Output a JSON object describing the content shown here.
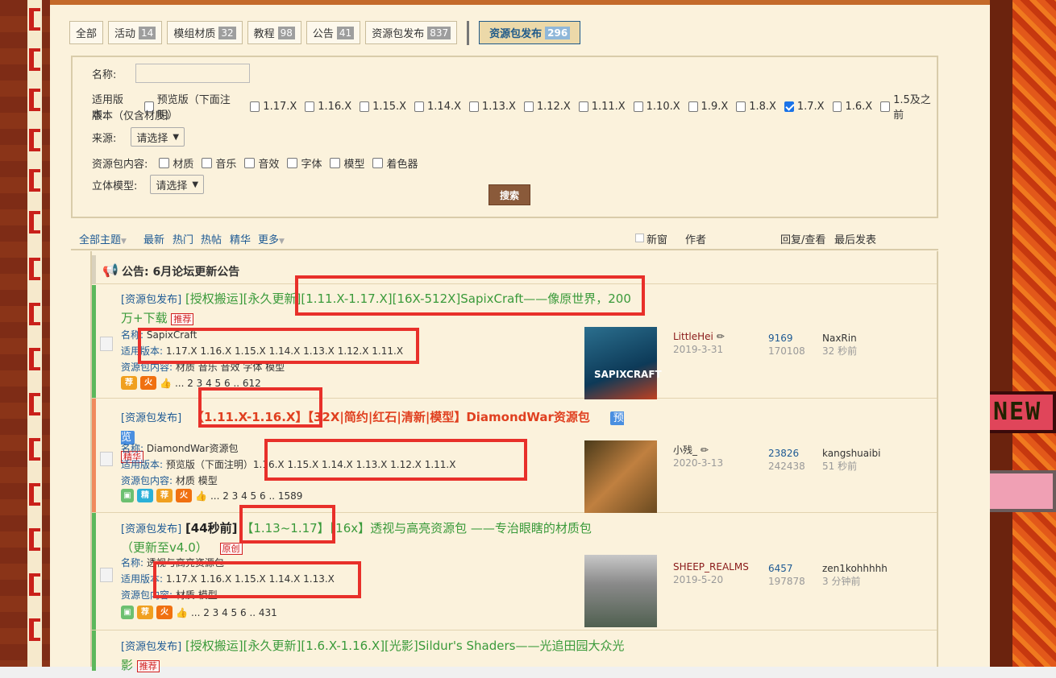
{
  "type_tabs": [
    {
      "label": "全部",
      "count": ""
    },
    {
      "label": "活动",
      "count": "14"
    },
    {
      "label": "模组材质",
      "count": "32"
    },
    {
      "label": "教程",
      "count": "98"
    },
    {
      "label": "公告",
      "count": "41"
    },
    {
      "label": "资源包发布",
      "count": "837"
    }
  ],
  "active_tab": {
    "label": "资源包发布",
    "count": "296"
  },
  "filter": {
    "name_label": "名称:",
    "version_label": "适用版本:",
    "version_label2": "版本（仅含材质）",
    "versions": [
      {
        "label": "预览版（下面注明）",
        "checked": false
      },
      {
        "label": "1.17.X",
        "checked": false
      },
      {
        "label": "1.16.X",
        "checked": false
      },
      {
        "label": "1.15.X",
        "checked": false
      },
      {
        "label": "1.14.X",
        "checked": false
      },
      {
        "label": "1.13.X",
        "checked": false
      },
      {
        "label": "1.12.X",
        "checked": false
      },
      {
        "label": "1.11.X",
        "checked": false
      },
      {
        "label": "1.10.X",
        "checked": false
      },
      {
        "label": "1.9.X",
        "checked": false
      },
      {
        "label": "1.8.X",
        "checked": false
      },
      {
        "label": "1.7.X",
        "checked": true
      },
      {
        "label": "1.6.X",
        "checked": false
      },
      {
        "label": "1.5及之前",
        "checked": false
      }
    ],
    "source_label": "来源:",
    "source_select": "请选择",
    "content_label": "资源包内容:",
    "contents": [
      "材质",
      "音乐",
      "音效",
      "字体",
      "模型",
      "着色器"
    ],
    "model_label": "立体模型:",
    "model_select": "请选择",
    "search_button": "搜索"
  },
  "sort_bar": {
    "all": "全部主题",
    "latest": "最新",
    "hot": "热门",
    "hot_post": "热帖",
    "digest": "精华",
    "more": "更多",
    "new_window": "新窗",
    "author": "作者",
    "reply_view": "回复/查看",
    "last_post": "最后发表"
  },
  "announcement": {
    "prefix": "公告:",
    "title": "6月论坛更新公告"
  },
  "threads": [
    {
      "tag": "[资源包发布]",
      "title_l1": "[授权搬运][永久更新][1.11.X-1.17.X][16X-512X]SapixCraft——像原世界，200",
      "title_l2": "万+下载",
      "badge": "推荐",
      "name_label": "名称:",
      "name": "SapixCraft",
      "ver_label": "适用版本:",
      "versions": "1.17.X 1.16.X 1.15.X 1.14.X 1.13.X 1.12.X 1.11.X",
      "content_label": "资源包内容:",
      "content": "材质 音乐 音效 字体 模型",
      "pages": "... 2  3  4  5  6 .. 612",
      "author": "LittleHei",
      "date": "2019-3-31",
      "replies": "9169",
      "views": "170108",
      "last_user": "NaxRin",
      "last_time": "32 秒前"
    },
    {
      "tag": "[资源包发布]",
      "title_l1": "【1.11.X-1.16.X】【32X|简约|红石|清新|模型】DiamondWar资源包",
      "preview": "预览",
      "badge": "精华",
      "name_label": "名称:",
      "name": "DiamondWar资源包",
      "ver_label": "适用版本:",
      "versions": "预览版（下面注明）1.16.X 1.15.X 1.14.X 1.13.X 1.12.X 1.11.X",
      "content_label": "资源包内容:",
      "content": "材质 模型",
      "pages": "... 2  3  4  5  6 .. 1589",
      "author": "小残_",
      "date": "2020-3-13",
      "replies": "23826",
      "views": "242438",
      "last_user": "kangshuaibi",
      "last_time": "51 秒前"
    },
    {
      "tag": "[资源包发布]",
      "title_time": "[44秒前]",
      "title_l1": "【1.13~1.17】【16x】透视与高亮资源包 ——专治眼瞎的材质包",
      "title_l2": "（更新至v4.0）",
      "badge": "原创",
      "name_label": "名称:",
      "name": "透视与高亮资源包",
      "ver_label": "适用版本:",
      "versions": "1.17.X 1.16.X 1.15.X 1.14.X 1.13.X",
      "content_label": "资源包内容:",
      "content": "材质 模型",
      "pages": "... 2  3  4  5  6 .. 431",
      "author": "SHEEP_REALMS",
      "date": "2019-5-20",
      "replies": "6457",
      "views": "197878",
      "last_user": "zen1kohhhhh",
      "last_time": "3 分钟前"
    },
    {
      "tag": "[资源包发布]",
      "title_l1": "[授权搬运][永久更新][1.6.X-1.16.X][光影]Sildur's Shaders——光追田园大众光",
      "title_l2": "影",
      "badge": "推荐"
    }
  ],
  "deco": {
    "new_sign": "NEW"
  }
}
